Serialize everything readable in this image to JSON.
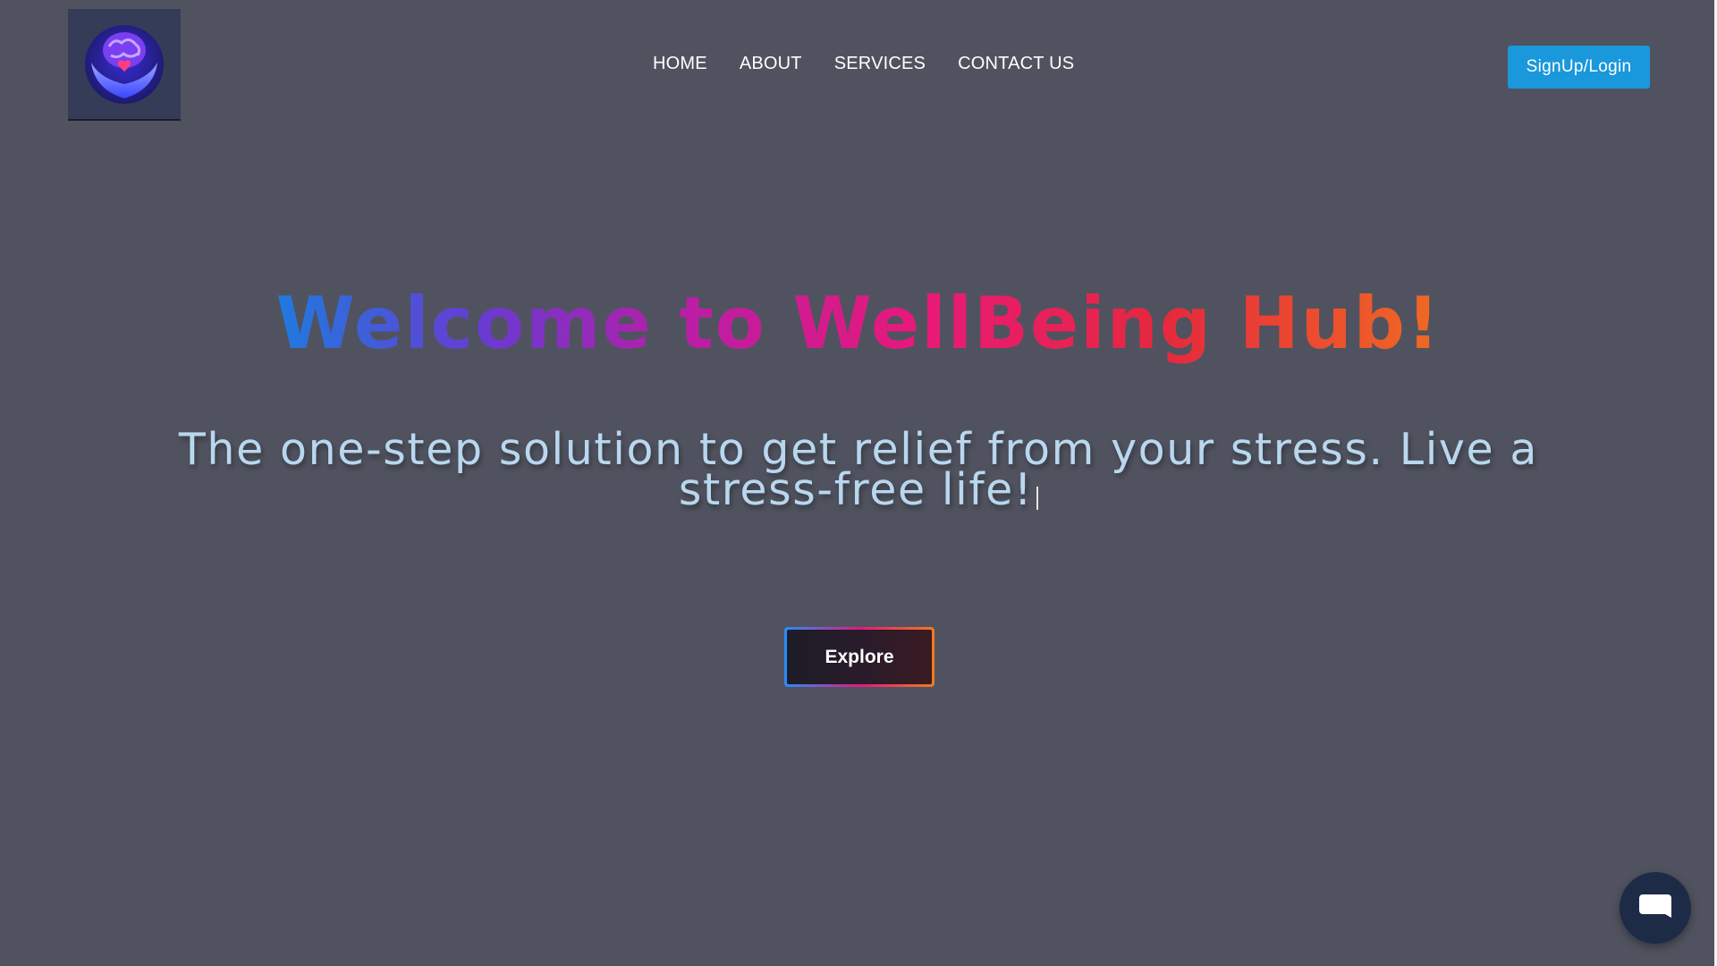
{
  "brand": {
    "logo_icon": "brain-in-hands-icon"
  },
  "nav": {
    "items": [
      {
        "label": "HOME"
      },
      {
        "label": "ABOUT"
      },
      {
        "label": "SERVICES"
      },
      {
        "label": "CONTACT US"
      }
    ]
  },
  "auth": {
    "signup_label": "SignUp/Login"
  },
  "hero": {
    "headline": "Welcome to WellBeing Hub!",
    "tagline": "The one-step solution to get relief from your stress. Live a stress-free life!",
    "cta_label": "Explore"
  },
  "chat": {
    "icon": "chat-bubble-icon"
  },
  "colors": {
    "background": "#50535f",
    "signup_button": "#1a98dc",
    "tagline_text": "#b9d7ee",
    "headline_gradient": [
      "#1f7ae0",
      "#b71ea9",
      "#e8197a",
      "#ef6a22"
    ],
    "chat_button": "#1e2b47"
  }
}
